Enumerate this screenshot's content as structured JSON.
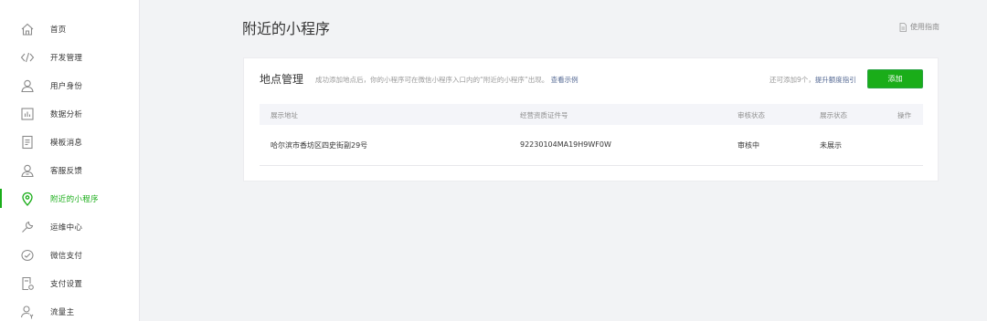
{
  "sidebar": {
    "items": [
      {
        "label": "首页",
        "icon": "home-icon"
      },
      {
        "label": "开发管理",
        "icon": "code-icon"
      },
      {
        "label": "用户身份",
        "icon": "user-icon"
      },
      {
        "label": "数据分析",
        "icon": "bar-chart-icon"
      },
      {
        "label": "模板消息",
        "icon": "document-icon"
      },
      {
        "label": "客服反馈",
        "icon": "support-icon"
      },
      {
        "label": "附近的小程序",
        "icon": "location-pin-icon",
        "active": true
      },
      {
        "label": "运维中心",
        "icon": "wrench-icon"
      },
      {
        "label": "微信支付",
        "icon": "payment-icon"
      },
      {
        "label": "支付设置",
        "icon": "payment-settings-icon"
      },
      {
        "label": "流量主",
        "icon": "user-money-icon"
      }
    ]
  },
  "header": {
    "title": "附近的小程序",
    "guide_link": "使用指南"
  },
  "card": {
    "title": "地点管理",
    "description": "成功添加地点后，你的小程序可在微信小程序入口内的“附近的小程序”出现。",
    "example_link": "查看示例",
    "quota_text": "还可添加9个，",
    "quota_link": "提升额度指引",
    "add_button": "添加"
  },
  "table": {
    "columns": [
      "展示地址",
      "经营资质证件号",
      "审核状态",
      "展示状态",
      "操作"
    ],
    "rows": [
      [
        "哈尔滨市香坊区四史街副29号",
        "92230104MA19H9WF0W",
        "审核中",
        "未展示",
        ""
      ]
    ]
  },
  "colors": {
    "accent": "#1aad19",
    "link": "#576b95",
    "background": "#f2f3f5"
  }
}
